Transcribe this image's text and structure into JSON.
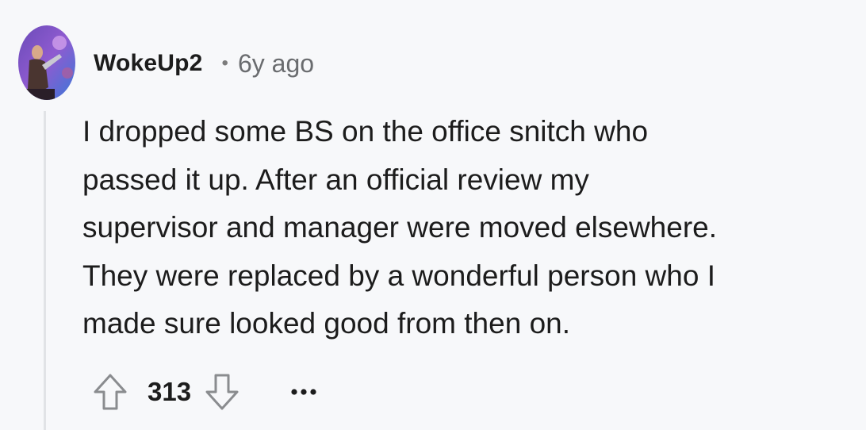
{
  "comment": {
    "username": "WokeUp2",
    "separator": "•",
    "timestamp": "6y ago",
    "body_lines": [
      "I dropped some BS on the office snitch who",
      "passed it up. After an official review my",
      "supervisor and manager were moved elsewhere.",
      "They were replaced by a wonderful person who I",
      "made sure looked good from then on."
    ],
    "score": "313"
  },
  "icons": {
    "upvote": "upvote-arrow-icon",
    "downvote": "downvote-arrow-icon",
    "more": "more-options-icon"
  },
  "colors": {
    "background": "#f7f8fa",
    "text": "#1c1c1c",
    "muted": "#6a6c6f",
    "thread_line": "#e1e3e6"
  }
}
